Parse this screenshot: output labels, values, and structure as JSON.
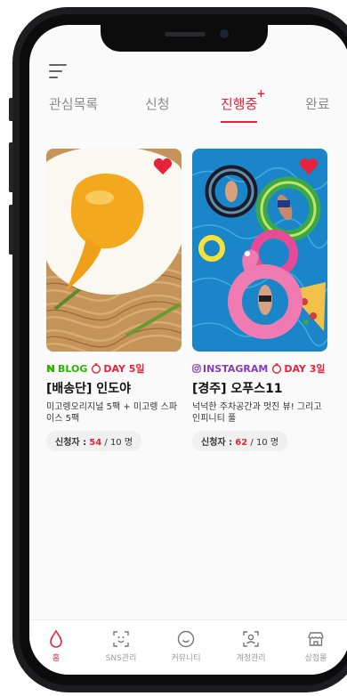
{
  "app": {
    "accent_color": "#e5243b"
  },
  "tabs": [
    {
      "label": "관심목록",
      "icon": ""
    },
    {
      "label": "신청",
      "icon": ""
    },
    {
      "label": "진행중",
      "icon": "new-plus-icon",
      "badge": "+"
    },
    {
      "label": "완료",
      "icon": ""
    }
  ],
  "active_tab": "진행중",
  "campaigns": [
    {
      "platform": "BLOG",
      "platform_icon": "naver-n-icon",
      "platform_color": "#2db400",
      "dday": "DAY 5일",
      "dday_icon": "timer-icon",
      "title": "[배송단] 인도야",
      "description": "미고렝오리지널 5팩 + 미고렝 스파이스 5팩",
      "applicants_label": "신청자 :",
      "applicants": "54",
      "capacity": "/ 10 명",
      "image": "fried-egg-noodles-photo",
      "liked": true
    },
    {
      "platform": "INSTAGRAM",
      "platform_icon": "instagram-icon",
      "platform_color": "#8a3ab9",
      "dday": "DAY 3일",
      "dday_icon": "timer-icon",
      "title": "[경주] 오푸스11",
      "description": "넉넉한 주차공간과 멋진 뷰! 그리고 인피니티 풀",
      "applicants_label": "신청자 :",
      "applicants": "62",
      "capacity": "/ 10 명",
      "image": "pool-floats-aerial-photo",
      "liked": true
    }
  ],
  "bottom_nav": [
    {
      "label": "홈",
      "icon": "drop-home-icon",
      "active": true
    },
    {
      "label": "SNS관리",
      "icon": "face-scan-icon",
      "active": false
    },
    {
      "label": "커뮤니티",
      "icon": "smile-icon",
      "active": false
    },
    {
      "label": "계정관리",
      "icon": "account-scan-icon",
      "active": false
    },
    {
      "label": "상점몰",
      "icon": "store-icon",
      "active": false
    }
  ]
}
